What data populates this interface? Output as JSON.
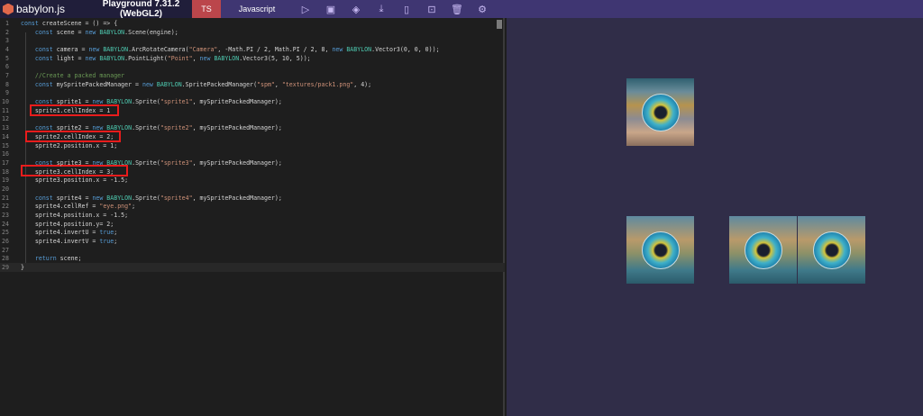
{
  "header": {
    "logo": "babylon.js",
    "version": "Playground 7.31.2 (WebGL2)",
    "ts_tab": "TS",
    "js_tab": "Javascript",
    "icons": [
      "play-icon",
      "save-icon",
      "inspector-icon",
      "download-icon",
      "new-file-icon",
      "code-icon",
      "delete-icon",
      "settings-icon"
    ],
    "icon_glyphs": [
      "▷",
      "▣",
      "◈",
      "⤓",
      "▯",
      "⊡",
      "🗑",
      "⚙"
    ]
  },
  "editor": {
    "lines": [
      [
        [
          "kw",
          "const "
        ],
        [
          "",
          "createScene = () => {"
        ]
      ],
      [
        [
          "kw",
          "    const "
        ],
        [
          "",
          "scene = "
        ],
        [
          "kw",
          "new "
        ],
        [
          "ty",
          "BABYLON"
        ],
        [
          "",
          ".Scene(engine);"
        ]
      ],
      [],
      [
        [
          "kw",
          "    const "
        ],
        [
          "",
          "camera = "
        ],
        [
          "kw",
          "new "
        ],
        [
          "ty",
          "BABYLON"
        ],
        [
          "",
          ".ArcRotateCamera("
        ],
        [
          "st",
          "\"Camera\""
        ],
        [
          "",
          ", -Math.PI / 2, Math.PI / 2, 8, "
        ],
        [
          "kw",
          "new "
        ],
        [
          "ty",
          "BABYLON"
        ],
        [
          "",
          ".Vector3(0, 0, 0));"
        ]
      ],
      [
        [
          "kw",
          "    const "
        ],
        [
          "",
          "light = "
        ],
        [
          "kw",
          "new "
        ],
        [
          "ty",
          "BABYLON"
        ],
        [
          "",
          ".PointLight("
        ],
        [
          "st",
          "\"Point\""
        ],
        [
          "",
          ", "
        ],
        [
          "kw",
          "new "
        ],
        [
          "ty",
          "BABYLON"
        ],
        [
          "",
          ".Vector3(5, 10, 5));"
        ]
      ],
      [],
      [
        [
          "cm",
          "    //Create a packed manager"
        ]
      ],
      [
        [
          "kw",
          "    const "
        ],
        [
          "",
          "mySpritePackedManager = "
        ],
        [
          "kw",
          "new "
        ],
        [
          "ty",
          "BABYLON"
        ],
        [
          "",
          ".SpritePackedManager("
        ],
        [
          "st",
          "\"spm\""
        ],
        [
          "",
          ", "
        ],
        [
          "st",
          "\"textures/pack1.png\""
        ],
        [
          "",
          ", 4);"
        ]
      ],
      [],
      [
        [
          "kw",
          "    const "
        ],
        [
          "",
          "sprite1 = "
        ],
        [
          "kw",
          "new "
        ],
        [
          "ty",
          "BABYLON"
        ],
        [
          "",
          ".Sprite("
        ],
        [
          "st",
          "\"sprite1\""
        ],
        [
          "",
          ", mySpritePackedManager);"
        ]
      ],
      [
        [
          "",
          "    sprite1.cellIndex = 1"
        ]
      ],
      [],
      [
        [
          "kw",
          "    const "
        ],
        [
          "",
          "sprite2 = "
        ],
        [
          "kw",
          "new "
        ],
        [
          "ty",
          "BABYLON"
        ],
        [
          "",
          ".Sprite("
        ],
        [
          "st",
          "\"sprite2\""
        ],
        [
          "",
          ", mySpritePackedManager);"
        ]
      ],
      [
        [
          "",
          "    sprite2.cellIndex = 2;"
        ]
      ],
      [
        [
          "",
          "    sprite2.position.x = 1;"
        ]
      ],
      [],
      [
        [
          "kw",
          "    const "
        ],
        [
          "",
          "sprite3 = "
        ],
        [
          "kw",
          "new "
        ],
        [
          "ty",
          "BABYLON"
        ],
        [
          "",
          ".Sprite("
        ],
        [
          "st",
          "\"sprite3\""
        ],
        [
          "",
          ", mySpritePackedManager);"
        ]
      ],
      [
        [
          "",
          "    sprite3.cellIndex = 3;"
        ]
      ],
      [
        [
          "",
          "    sprite3.position.x = -1.5;"
        ]
      ],
      [],
      [
        [
          "kw",
          "    const "
        ],
        [
          "",
          "sprite4 = "
        ],
        [
          "kw",
          "new "
        ],
        [
          "ty",
          "BABYLON"
        ],
        [
          "",
          ".Sprite("
        ],
        [
          "st",
          "\"sprite4\""
        ],
        [
          "",
          ", mySpritePackedManager);"
        ]
      ],
      [
        [
          "",
          "    sprite4.cellRef = "
        ],
        [
          "st",
          "\"eye.png\""
        ],
        [
          "",
          ";"
        ]
      ],
      [
        [
          "",
          "    sprite4.position.x = -1.5;"
        ]
      ],
      [
        [
          "",
          "    sprite4.position.y= 2;"
        ]
      ],
      [
        [
          "",
          "    sprite4.invertU = "
        ],
        [
          "kw",
          "true"
        ],
        [
          "",
          ";"
        ]
      ],
      [
        [
          "",
          "    sprite4.invertV = "
        ],
        [
          "kw",
          "true"
        ],
        [
          "",
          ";"
        ]
      ],
      [],
      [
        [
          "kw",
          "    return "
        ],
        [
          "",
          "scene;"
        ]
      ],
      [
        [
          "",
          "}"
        ]
      ]
    ]
  }
}
